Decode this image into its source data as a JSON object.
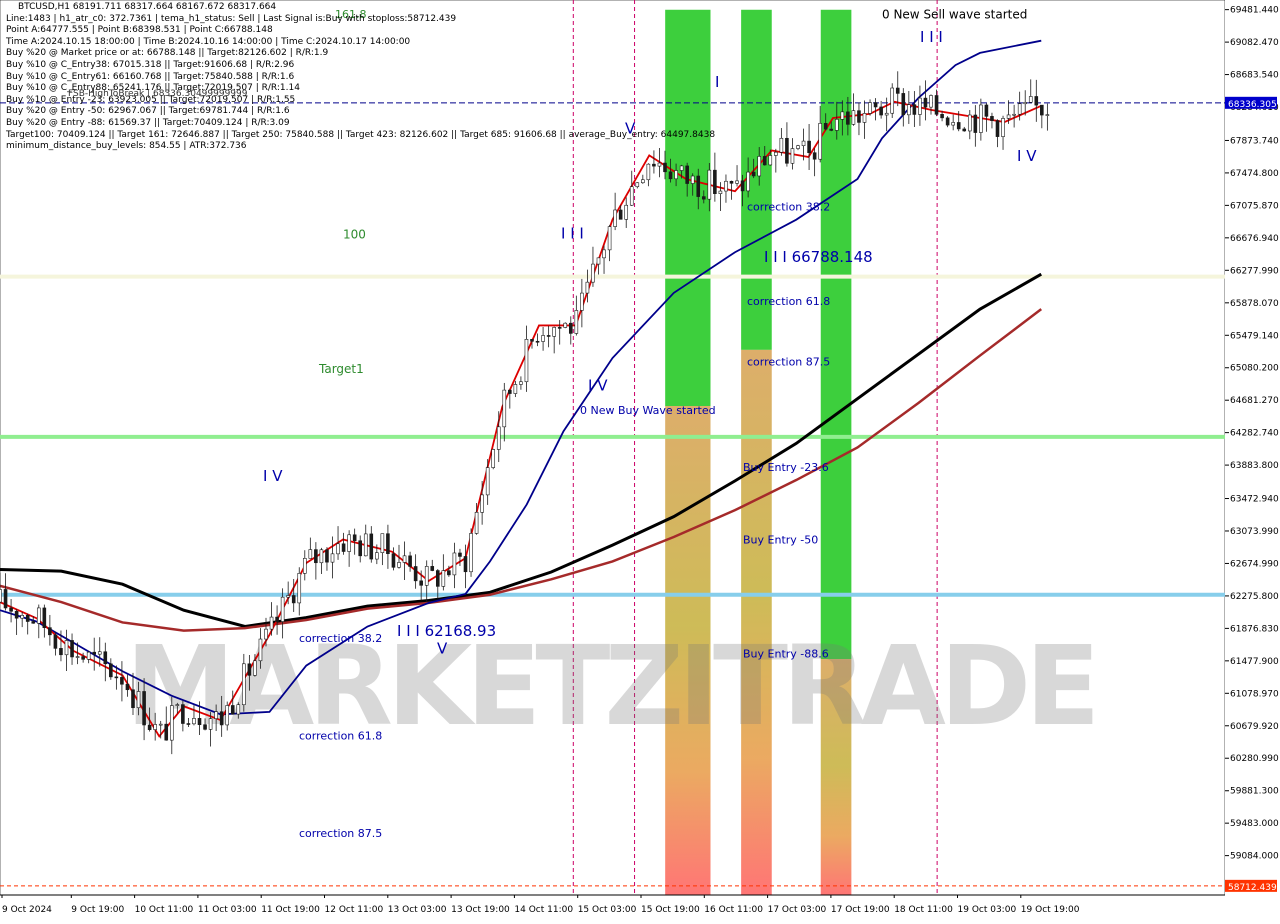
{
  "header": {
    "symbol_line": "BTCUSD,H1  68191.711 68317.664 68167.672 68317.664",
    "info_lines": [
      "Line:1483 | h1_atr_c0: 372.7361 | tema_h1_status: Sell | Last Signal is:Buy with stoploss:58712.439",
      "Point A:64777.555 | Point B:68398.531 | Point C:66788.148",
      "Time A:2024.10.15 18:00:00 | Time B:2024.10.16 14:00:00 | Time C:2024.10.17 14:00:00",
      "Buy %20 @ Market price or at: 66788.148 || Target:82126.602 | R/R:1.9",
      "Buy %10 @ C_Entry38: 67015.318 || Target:91606.68 | R/R:2.96",
      "Buy %10 @ C_Entry61: 66160.768 || Target:75840.588 | R/R:1.6",
      "Buy %10 @ C_Entry88: 65241.176 || Target:72019.507 | R/R:1.14",
      "Buy %10 @ Entry -23: 63923.005 || Target:72019.507 | R/R:1.55",
      "Buy %20 @ Entry -50: 62967.067 || Target:69781.744 | R/R:1.6",
      "Buy %20 @ Entry -88: 61569.37 || Target:70409.124 | R/R:3.09",
      "Target100: 70409.124 || Target 161: 72646.887 || Target 250: 75840.588 || Target 423: 82126.602 || Target 685: 91606.68 || average_Buy_entry: 64497.8438",
      "minimum_distance_buy_levels: 854.55 | ATR:372.736"
    ],
    "overlap_text": "FSB-HighToBreak | 68336.30499999999"
  },
  "chart_data": {
    "type": "line",
    "symbol": "BTCUSD",
    "timeframe": "H1",
    "ylim": [
      58600,
      69600
    ],
    "y_ticks": [
      69481.4,
      69082.47,
      68683.54,
      68284.61,
      67873.74,
      67474.8,
      67075.87,
      66676.94,
      66277.99,
      65878.07,
      65479.14,
      65080.2,
      64681.27,
      64282.74,
      63883.8,
      63472.94,
      63073.99,
      62674.99,
      62275.8,
      61876.83,
      61477.9,
      61078.97,
      60679.92,
      60280.99,
      59881.3,
      59483.0,
      59084.0
    ],
    "y_tick_labels": [
      "69481.440",
      "69082.470",
      "68683.540",
      "68284.610",
      "67873.740",
      "67474.800",
      "67075.870",
      "66676.940",
      "66277.990",
      "65878.070",
      "65479.140",
      "65080.200",
      "64681.270",
      "64282.740",
      "63883.800",
      "63472.940",
      "63073.990",
      "62674.990",
      "62275.800",
      "61876.830",
      "61477.900",
      "61078.970",
      "60679.920",
      "60280.990",
      "59881.300",
      "59483.000",
      "59084.000"
    ],
    "x_labels": [
      "9 Oct 2024",
      "9 Oct 19:00",
      "10 Oct 11:00",
      "11 Oct 03:00",
      "11 Oct 19:00",
      "12 Oct 11:00",
      "13 Oct 03:00",
      "13 Oct 19:00",
      "14 Oct 11:00",
      "15 Oct 03:00",
      "15 Oct 19:00",
      "16 Oct 11:00",
      "17 Oct 03:00",
      "17 Oct 19:00",
      "18 Oct 11:00",
      "19 Oct 03:00",
      "19 Oct 19:00"
    ],
    "current_price": {
      "value": 68336.305,
      "label": "68336.305",
      "color": "#0000cc"
    },
    "stoploss_price": {
      "value": 58712.439,
      "label": "58712.439",
      "color": "#ff3300"
    },
    "horizontal_levels": [
      {
        "value": 66200,
        "color": "#f5f5dc",
        "name": "100",
        "label": "100"
      },
      {
        "value": 64230,
        "color": "#90ee90",
        "name": "Target1",
        "label": "Target1"
      },
      {
        "value": 62290,
        "color": "#87ceeb",
        "name": "base",
        "label": ""
      }
    ],
    "fib_labels_left": [
      {
        "text": "161.8",
        "value": 69430
      },
      {
        "text": "correction 38.2",
        "value": 61760
      },
      {
        "text": "correction 61.8",
        "value": 60560
      },
      {
        "text": "correction 87.5",
        "value": 59360
      }
    ],
    "zone_labels": [
      {
        "text": "correction 38.2",
        "value": 67060
      },
      {
        "text": "correction 61.8",
        "value": 65900
      },
      {
        "text": "correction 87.5",
        "value": 65160
      },
      {
        "text": "Buy Entry -23.6",
        "value": 63860
      },
      {
        "text": "Buy Entry -50",
        "value": 62970
      },
      {
        "text": "Buy Entry -88.6",
        "value": 61570
      }
    ],
    "wave_labels": [
      {
        "text": "0 New Sell wave started",
        "value": 69420
      },
      {
        "text": "0 New Buy Wave started",
        "value": 64560
      },
      {
        "text": "I I I 66788.148",
        "value": 66430
      },
      {
        "text": "I I I 62168.93",
        "value": 61830
      },
      {
        "text": "I I I",
        "value": 66720
      },
      {
        "text": "I V",
        "value": 64850
      },
      {
        "text": "V",
        "value": 68010
      },
      {
        "text": "I I I",
        "value": 69130
      },
      {
        "text": "I V",
        "value": 67670
      },
      {
        "text": "I V",
        "value": 63740
      },
      {
        "text": "V",
        "value": 61620
      },
      {
        "text": "I",
        "value": 68580
      }
    ],
    "series": [
      {
        "name": "MA200",
        "color": "#000000",
        "x": [
          0,
          0.05,
          0.1,
          0.15,
          0.2,
          0.25,
          0.3,
          0.35,
          0.4,
          0.45,
          0.5,
          0.55,
          0.6,
          0.65,
          0.7,
          0.75,
          0.8,
          0.85
        ],
        "values": [
          62600,
          62580,
          62420,
          62100,
          61900,
          62010,
          62150,
          62220,
          62320,
          62570,
          62900,
          63250,
          63690,
          64150,
          64700,
          65250,
          65800,
          66230
        ]
      },
      {
        "name": "MA_slow",
        "color": "#a52a2a",
        "x": [
          0,
          0.05,
          0.1,
          0.15,
          0.2,
          0.25,
          0.3,
          0.35,
          0.4,
          0.45,
          0.5,
          0.55,
          0.6,
          0.65,
          0.7,
          0.75,
          0.8,
          0.85
        ],
        "values": [
          62400,
          62200,
          61950,
          61850,
          61880,
          61980,
          62120,
          62190,
          62290,
          62480,
          62700,
          63000,
          63330,
          63700,
          64100,
          64650,
          65230,
          65800
        ]
      },
      {
        "name": "MA_mid",
        "color": "#00008b",
        "x": [
          0,
          0.03,
          0.06,
          0.1,
          0.14,
          0.18,
          0.22,
          0.25,
          0.3,
          0.35,
          0.38,
          0.4,
          0.43,
          0.46,
          0.5,
          0.55,
          0.6,
          0.65,
          0.7,
          0.72,
          0.75,
          0.78,
          0.8,
          0.85
        ],
        "values": [
          62100,
          61960,
          61700,
          61350,
          61050,
          60820,
          60850,
          61420,
          61900,
          62190,
          62300,
          62700,
          63400,
          64300,
          65200,
          66000,
          66500,
          66900,
          67400,
          67900,
          68400,
          68800,
          68950,
          69100
        ]
      },
      {
        "name": "MA_fast",
        "color": "#dd0000",
        "x": [
          0,
          0.03,
          0.06,
          0.1,
          0.13,
          0.15,
          0.18,
          0.22,
          0.25,
          0.28,
          0.32,
          0.35,
          0.38,
          0.41,
          0.44,
          0.47,
          0.5,
          0.53,
          0.56,
          0.6,
          0.63,
          0.66,
          0.68,
          0.71,
          0.73,
          0.76,
          0.8,
          0.82,
          0.85
        ],
        "values": [
          62200,
          62000,
          61600,
          61300,
          60550,
          60920,
          60750,
          61800,
          62680,
          62970,
          62820,
          62460,
          62740,
          64600,
          65600,
          65600,
          66900,
          67690,
          67400,
          67250,
          67750,
          67670,
          68150,
          68200,
          68350,
          68250,
          68150,
          68100,
          68300
        ]
      }
    ],
    "bull_zone": [
      {
        "x0": 0.543,
        "x1": 0.58,
        "green_top": 69480,
        "green_bot": 64610,
        "tan_bot": 58600
      },
      {
        "x0": 0.605,
        "x1": 0.63,
        "green_top": 69480,
        "green_bot": 65300,
        "tan_bot": 58600
      },
      {
        "x0": 0.67,
        "x1": 0.695,
        "green_top": 69480,
        "green_bot": 61500,
        "tan_bot": 58600
      }
    ],
    "watermark": "MARKETZITRADE"
  },
  "colors": {
    "background": "#ffffff",
    "grid": "#e6e6e6",
    "current_price_bg": "#0000cc",
    "stoploss_bg": "#ff3300"
  }
}
